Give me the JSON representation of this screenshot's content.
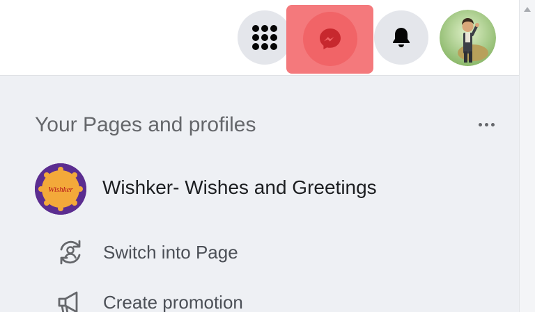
{
  "topbar": {
    "menu_icon": "grid-menu-icon",
    "messenger_icon": "messenger-icon",
    "notifications_icon": "bell-icon",
    "avatar_icon": "user-avatar",
    "highlight_color": "#f4797c"
  },
  "panel": {
    "section_title": "Your Pages and profiles",
    "more_icon": "more-dots-icon",
    "page": {
      "name": "Wishker- Wishes and Greetings",
      "logo_text": "Wishker"
    },
    "actions": [
      {
        "icon": "switch-profile-icon",
        "label": "Switch into Page"
      },
      {
        "icon": "megaphone-icon",
        "label": "Create promotion"
      }
    ]
  }
}
